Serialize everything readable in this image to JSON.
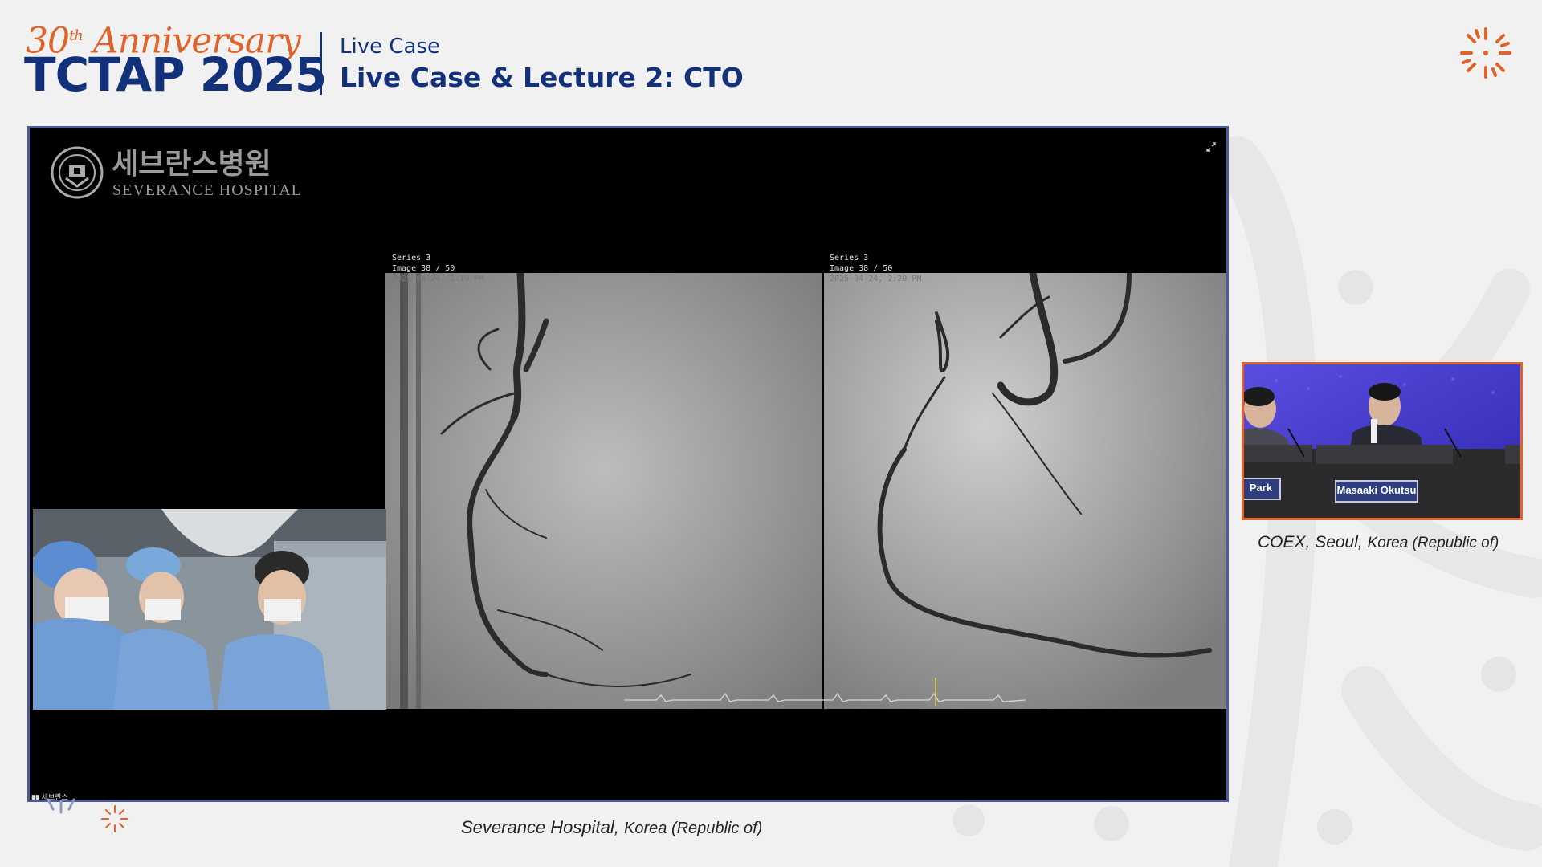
{
  "header": {
    "anniversary_number": "30",
    "anniversary_suffix": "th",
    "anniversary_word": "Anniversary",
    "event_name": "TCTAP 2025",
    "session_type": "Live Case",
    "session_title": "Live Case & Lecture 2: CTO"
  },
  "main_feed": {
    "hospital_name_korean": "세브란스병원",
    "hospital_name_english": "SEVERANCE HOSPITAL",
    "angio_left": {
      "series": "Series 3",
      "image": "Image 38 / 50",
      "datetime": "2025-04-24, 2:19 PM"
    },
    "angio_right": {
      "series": "Series 3",
      "image": "Image 38 / 50",
      "datetime": "2025-04-24, 2:20 PM"
    },
    "signal_label": "세브란스",
    "caption_location": "Severance Hospital,",
    "caption_country": "Korea (Republic of)"
  },
  "side_feed": {
    "nameplate_left": "Park",
    "nameplate_right": "Masaaki Okutsu",
    "caption_location": "COEX, Seoul,",
    "caption_country": "Korea (Republic of)"
  },
  "colors": {
    "brand_navy": "#13307a",
    "brand_orange": "#e0642a",
    "main_frame_border": "#4c5a97",
    "side_frame_border": "#e2632a"
  },
  "icons": [
    "sunburst-icon",
    "expand-icon",
    "severance-seal-icon",
    "signal-icon"
  ]
}
